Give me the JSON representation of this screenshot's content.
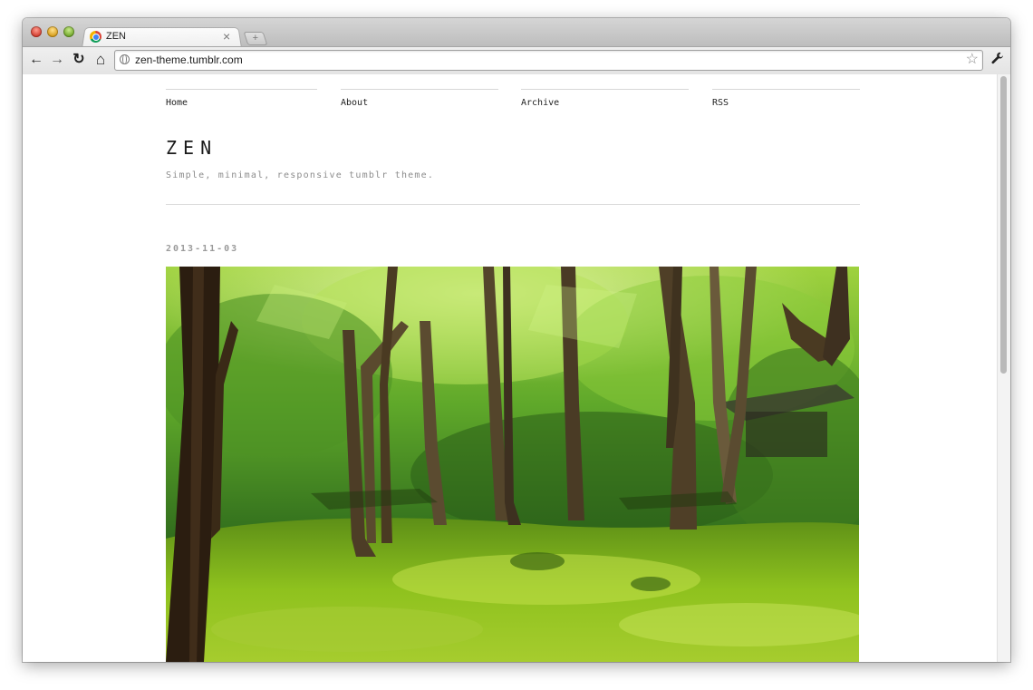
{
  "browser": {
    "tab_title": "ZEN",
    "tab_close": "×",
    "new_tab": "+",
    "url": "zen-theme.tumblr.com",
    "back_icon": "←",
    "forward_icon": "→",
    "reload_icon": "↻",
    "home_icon": "⌂",
    "star_icon": "☆",
    "wrench_icon": "🔧"
  },
  "site": {
    "nav": [
      {
        "label": "Home"
      },
      {
        "label": "About"
      },
      {
        "label": "Archive"
      },
      {
        "label": "RSS"
      }
    ],
    "title": "ZEN",
    "description": "Simple, minimal, responsive tumblr theme."
  },
  "post": {
    "date": "2013-11-03",
    "photo_subject": "moss-forest-photo"
  },
  "colors": {
    "text": "#222222",
    "muted": "#8c8c8c",
    "rule": "#dcdcdc"
  }
}
